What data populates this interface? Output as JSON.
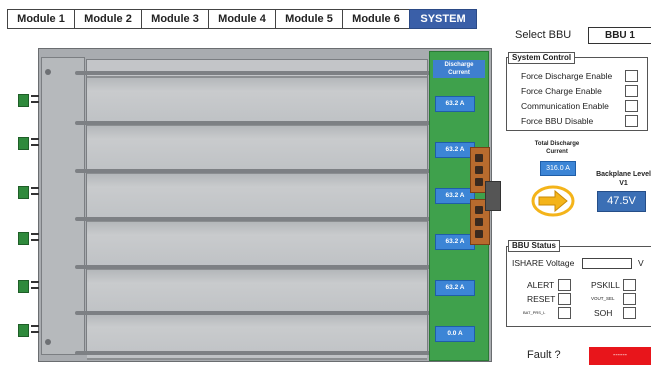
{
  "tabs": [
    "Module 1",
    "Module 2",
    "Module 3",
    "Module 4",
    "Module 5",
    "Module 6",
    "SYSTEM"
  ],
  "active_tab": "SYSTEM",
  "rack": {
    "pcb_title": "Discharge Current",
    "module_currents": [
      "63.2 A",
      "63.2 A",
      "63.2 A",
      "63.2 A",
      "63.2 A",
      "0.0 A"
    ]
  },
  "select_bbu": {
    "label": "Select BBU",
    "value": "BBU 1"
  },
  "system_control": {
    "title": "System Control",
    "items": [
      "Force Discharge Enable",
      "Force Charge Enable",
      "Communication Enable",
      "Force BBU Disable"
    ]
  },
  "total_discharge": {
    "label": "Total Discharge Current",
    "value": "316.0 A"
  },
  "backplane": {
    "label": "Backplane Level V1",
    "value": "47.5V"
  },
  "bbu_status": {
    "title": "BBU Status",
    "ishare_label": "ISHARE Voltage",
    "ishare_value": "",
    "ishare_unit": "V",
    "left_items": [
      "ALERT",
      "RESET",
      "BAT_PRS_L"
    ],
    "right_items": [
      "PSKILL",
      "VOUT_SEL",
      "SOH"
    ]
  },
  "fault": {
    "label": "Fault ?",
    "value": "------"
  },
  "colors": {
    "active_tab": "#3a5fa8",
    "pcb": "#3fa14c",
    "current_box": "#3c85d6",
    "fault": "#e8151b",
    "arrow": "#f4b41a"
  },
  "icons": [
    "arrow-right-icon"
  ]
}
